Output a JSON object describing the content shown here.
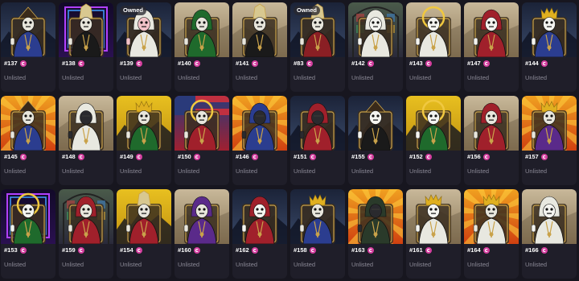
{
  "accent": "#d43d9e",
  "cards": [
    {
      "id": "#137",
      "status": "Unlisted",
      "owned": "",
      "bg": "dark",
      "robe": "#2b3d8f",
      "face": "skull",
      "hat": "triangle"
    },
    {
      "id": "#138",
      "status": "Unlisted",
      "owned": "",
      "bg": "neon",
      "robe": "#1a1a1a",
      "face": "skull",
      "hat": "mitre"
    },
    {
      "id": "#139",
      "status": "Unlisted",
      "owned": "Owned",
      "bg": "dark",
      "robe": "#e8e8e0",
      "face": "pink",
      "hat": "hood"
    },
    {
      "id": "#140",
      "status": "Unlisted",
      "owned": "",
      "bg": "stone",
      "robe": "#1f6a2c",
      "face": "skull",
      "hat": "hood"
    },
    {
      "id": "#141",
      "status": "Unlisted",
      "owned": "",
      "bg": "stone",
      "robe": "#1a1a1a",
      "face": "skull",
      "hat": "mitre"
    },
    {
      "id": "#83",
      "status": "Unlisted",
      "owned": "Owned",
      "bg": "dark",
      "robe": "#8a1f24",
      "face": "skull",
      "hat": "mitre"
    },
    {
      "id": "#142",
      "status": "Unlisted",
      "owned": "",
      "bg": "glass",
      "robe": "#e8e8e0",
      "face": "mask",
      "hat": "hood"
    },
    {
      "id": "#143",
      "status": "Unlisted",
      "owned": "",
      "bg": "stone",
      "robe": "#e8e8e0",
      "face": "mask",
      "hat": "halo"
    },
    {
      "id": "#147",
      "status": "Unlisted",
      "owned": "",
      "bg": "stone",
      "robe": "#a0202b",
      "face": "mask",
      "hat": "hood"
    },
    {
      "id": "#144",
      "status": "Unlisted",
      "owned": "",
      "bg": "dark",
      "robe": "#2b3d8f",
      "face": "mask",
      "hat": "crown"
    },
    {
      "id": "#145",
      "status": "Unlisted",
      "owned": "",
      "bg": "rays",
      "robe": "#2b3d8f",
      "face": "skull",
      "hat": "triangle"
    },
    {
      "id": "#148",
      "status": "Unlisted",
      "owned": "",
      "bg": "stone",
      "robe": "#e8e8e0",
      "face": "dark",
      "hat": "hood"
    },
    {
      "id": "#149",
      "status": "Unlisted",
      "owned": "",
      "bg": "gold",
      "robe": "#1f6a2c",
      "face": "skull",
      "hat": "crown"
    },
    {
      "id": "#150",
      "status": "Unlisted",
      "owned": "",
      "bg": "flag",
      "robe": "#a0202b",
      "face": "skull",
      "hat": "halo"
    },
    {
      "id": "#146",
      "status": "Unlisted",
      "owned": "",
      "bg": "rays",
      "robe": "#2b3d8f",
      "face": "dark",
      "hat": "hood"
    },
    {
      "id": "#151",
      "status": "Unlisted",
      "owned": "",
      "bg": "dark",
      "robe": "#a0202b",
      "face": "dark",
      "hat": "hood"
    },
    {
      "id": "#155",
      "status": "Unlisted",
      "owned": "",
      "bg": "dark",
      "robe": "#1a1a1a",
      "face": "mask",
      "hat": "triangle"
    },
    {
      "id": "#152",
      "status": "Unlisted",
      "owned": "",
      "bg": "gold",
      "robe": "#1f6a2c",
      "face": "mask",
      "hat": "halo"
    },
    {
      "id": "#156",
      "status": "Unlisted",
      "owned": "",
      "bg": "stone",
      "robe": "#a0202b",
      "face": "skull",
      "hat": "hood"
    },
    {
      "id": "#157",
      "status": "Unlisted",
      "owned": "",
      "bg": "rays",
      "robe": "#5a2a8a",
      "face": "skull",
      "hat": "crown"
    },
    {
      "id": "#153",
      "status": "Unlisted",
      "owned": "",
      "bg": "neon",
      "robe": "#1f6a2c",
      "face": "mask",
      "hat": "halo"
    },
    {
      "id": "#159",
      "status": "Unlisted",
      "owned": "",
      "bg": "glass",
      "robe": "#a0202b",
      "face": "skull",
      "hat": "hood"
    },
    {
      "id": "#154",
      "status": "Unlisted",
      "owned": "",
      "bg": "gold",
      "robe": "#a0202b",
      "face": "skull",
      "hat": "mitre"
    },
    {
      "id": "#160",
      "status": "Unlisted",
      "owned": "",
      "bg": "stone",
      "robe": "#5a2a8a",
      "face": "skull",
      "hat": "hood"
    },
    {
      "id": "#162",
      "status": "Unlisted",
      "owned": "",
      "bg": "dark",
      "robe": "#a0202b",
      "face": "mask",
      "hat": "hood"
    },
    {
      "id": "#158",
      "status": "Unlisted",
      "owned": "",
      "bg": "dark",
      "robe": "#2b3d8f",
      "face": "skull",
      "hat": "crown"
    },
    {
      "id": "#163",
      "status": "Unlisted",
      "owned": "",
      "bg": "rays",
      "robe": "#2a3a2a",
      "face": "dark",
      "hat": "hood"
    },
    {
      "id": "#161",
      "status": "Unlisted",
      "owned": "",
      "bg": "stone",
      "robe": "#e8e8e0",
      "face": "mask",
      "hat": "crown"
    },
    {
      "id": "#164",
      "status": "Unlisted",
      "owned": "",
      "bg": "rays",
      "robe": "#e8e8e0",
      "face": "skull",
      "hat": "crown"
    },
    {
      "id": "#166",
      "status": "Unlisted",
      "owned": "",
      "bg": "stone",
      "robe": "#e8e8e0",
      "face": "mask",
      "hat": "hood"
    }
  ]
}
